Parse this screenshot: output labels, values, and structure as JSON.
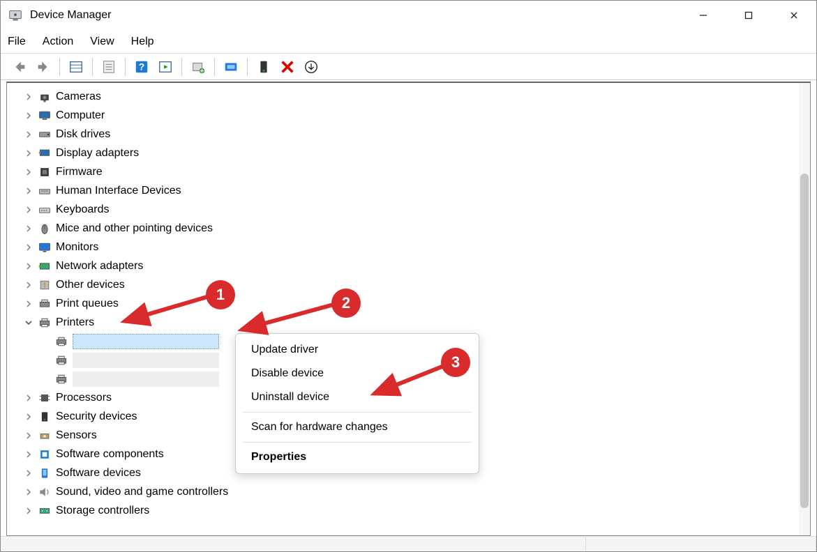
{
  "window": {
    "title": "Device Manager"
  },
  "menu": {
    "items": [
      "File",
      "Action",
      "View",
      "Help"
    ]
  },
  "tree": {
    "items": [
      {
        "id": "cameras",
        "label": "Cameras",
        "expandable": true
      },
      {
        "id": "computer",
        "label": "Computer",
        "expandable": true
      },
      {
        "id": "disk-drives",
        "label": "Disk drives",
        "expandable": true
      },
      {
        "id": "display-adapters",
        "label": "Display adapters",
        "expandable": true
      },
      {
        "id": "firmware",
        "label": "Firmware",
        "expandable": true
      },
      {
        "id": "hid",
        "label": "Human Interface Devices",
        "expandable": true
      },
      {
        "id": "keyboards",
        "label": "Keyboards",
        "expandable": true
      },
      {
        "id": "mice",
        "label": "Mice and other pointing devices",
        "expandable": true
      },
      {
        "id": "monitors",
        "label": "Monitors",
        "expandable": true
      },
      {
        "id": "network-adapters",
        "label": "Network adapters",
        "expandable": true
      },
      {
        "id": "other-devices",
        "label": "Other devices",
        "expandable": true
      },
      {
        "id": "print-queues",
        "label": "Print queues",
        "expandable": true
      },
      {
        "id": "printers",
        "label": "Printers",
        "expandable": true,
        "expanded": true,
        "children": [
          {
            "id": "printer-0",
            "selected": true
          },
          {
            "id": "printer-1",
            "grey": true
          },
          {
            "id": "printer-2",
            "grey": true
          }
        ]
      },
      {
        "id": "processors",
        "label": "Processors",
        "expandable": true
      },
      {
        "id": "security-devices",
        "label": "Security devices",
        "expandable": true
      },
      {
        "id": "sensors",
        "label": "Sensors",
        "expandable": true
      },
      {
        "id": "software-components",
        "label": "Software components",
        "expandable": true
      },
      {
        "id": "software-devices",
        "label": "Software devices",
        "expandable": true
      },
      {
        "id": "sound",
        "label": "Sound, video and game controllers",
        "expandable": true
      },
      {
        "id": "storage-controllers",
        "label": "Storage controllers",
        "expandable": true
      }
    ]
  },
  "context_menu": {
    "items": [
      {
        "label": "Update driver",
        "type": "item"
      },
      {
        "label": "Disable device",
        "type": "item"
      },
      {
        "label": "Uninstall device",
        "type": "item"
      },
      {
        "type": "sep"
      },
      {
        "label": "Scan for hardware changes",
        "type": "item"
      },
      {
        "type": "sep"
      },
      {
        "label": "Properties",
        "type": "item",
        "bold": true
      }
    ]
  },
  "annotations": {
    "badges": {
      "b1": "1",
      "b2": "2",
      "b3": "3"
    }
  }
}
